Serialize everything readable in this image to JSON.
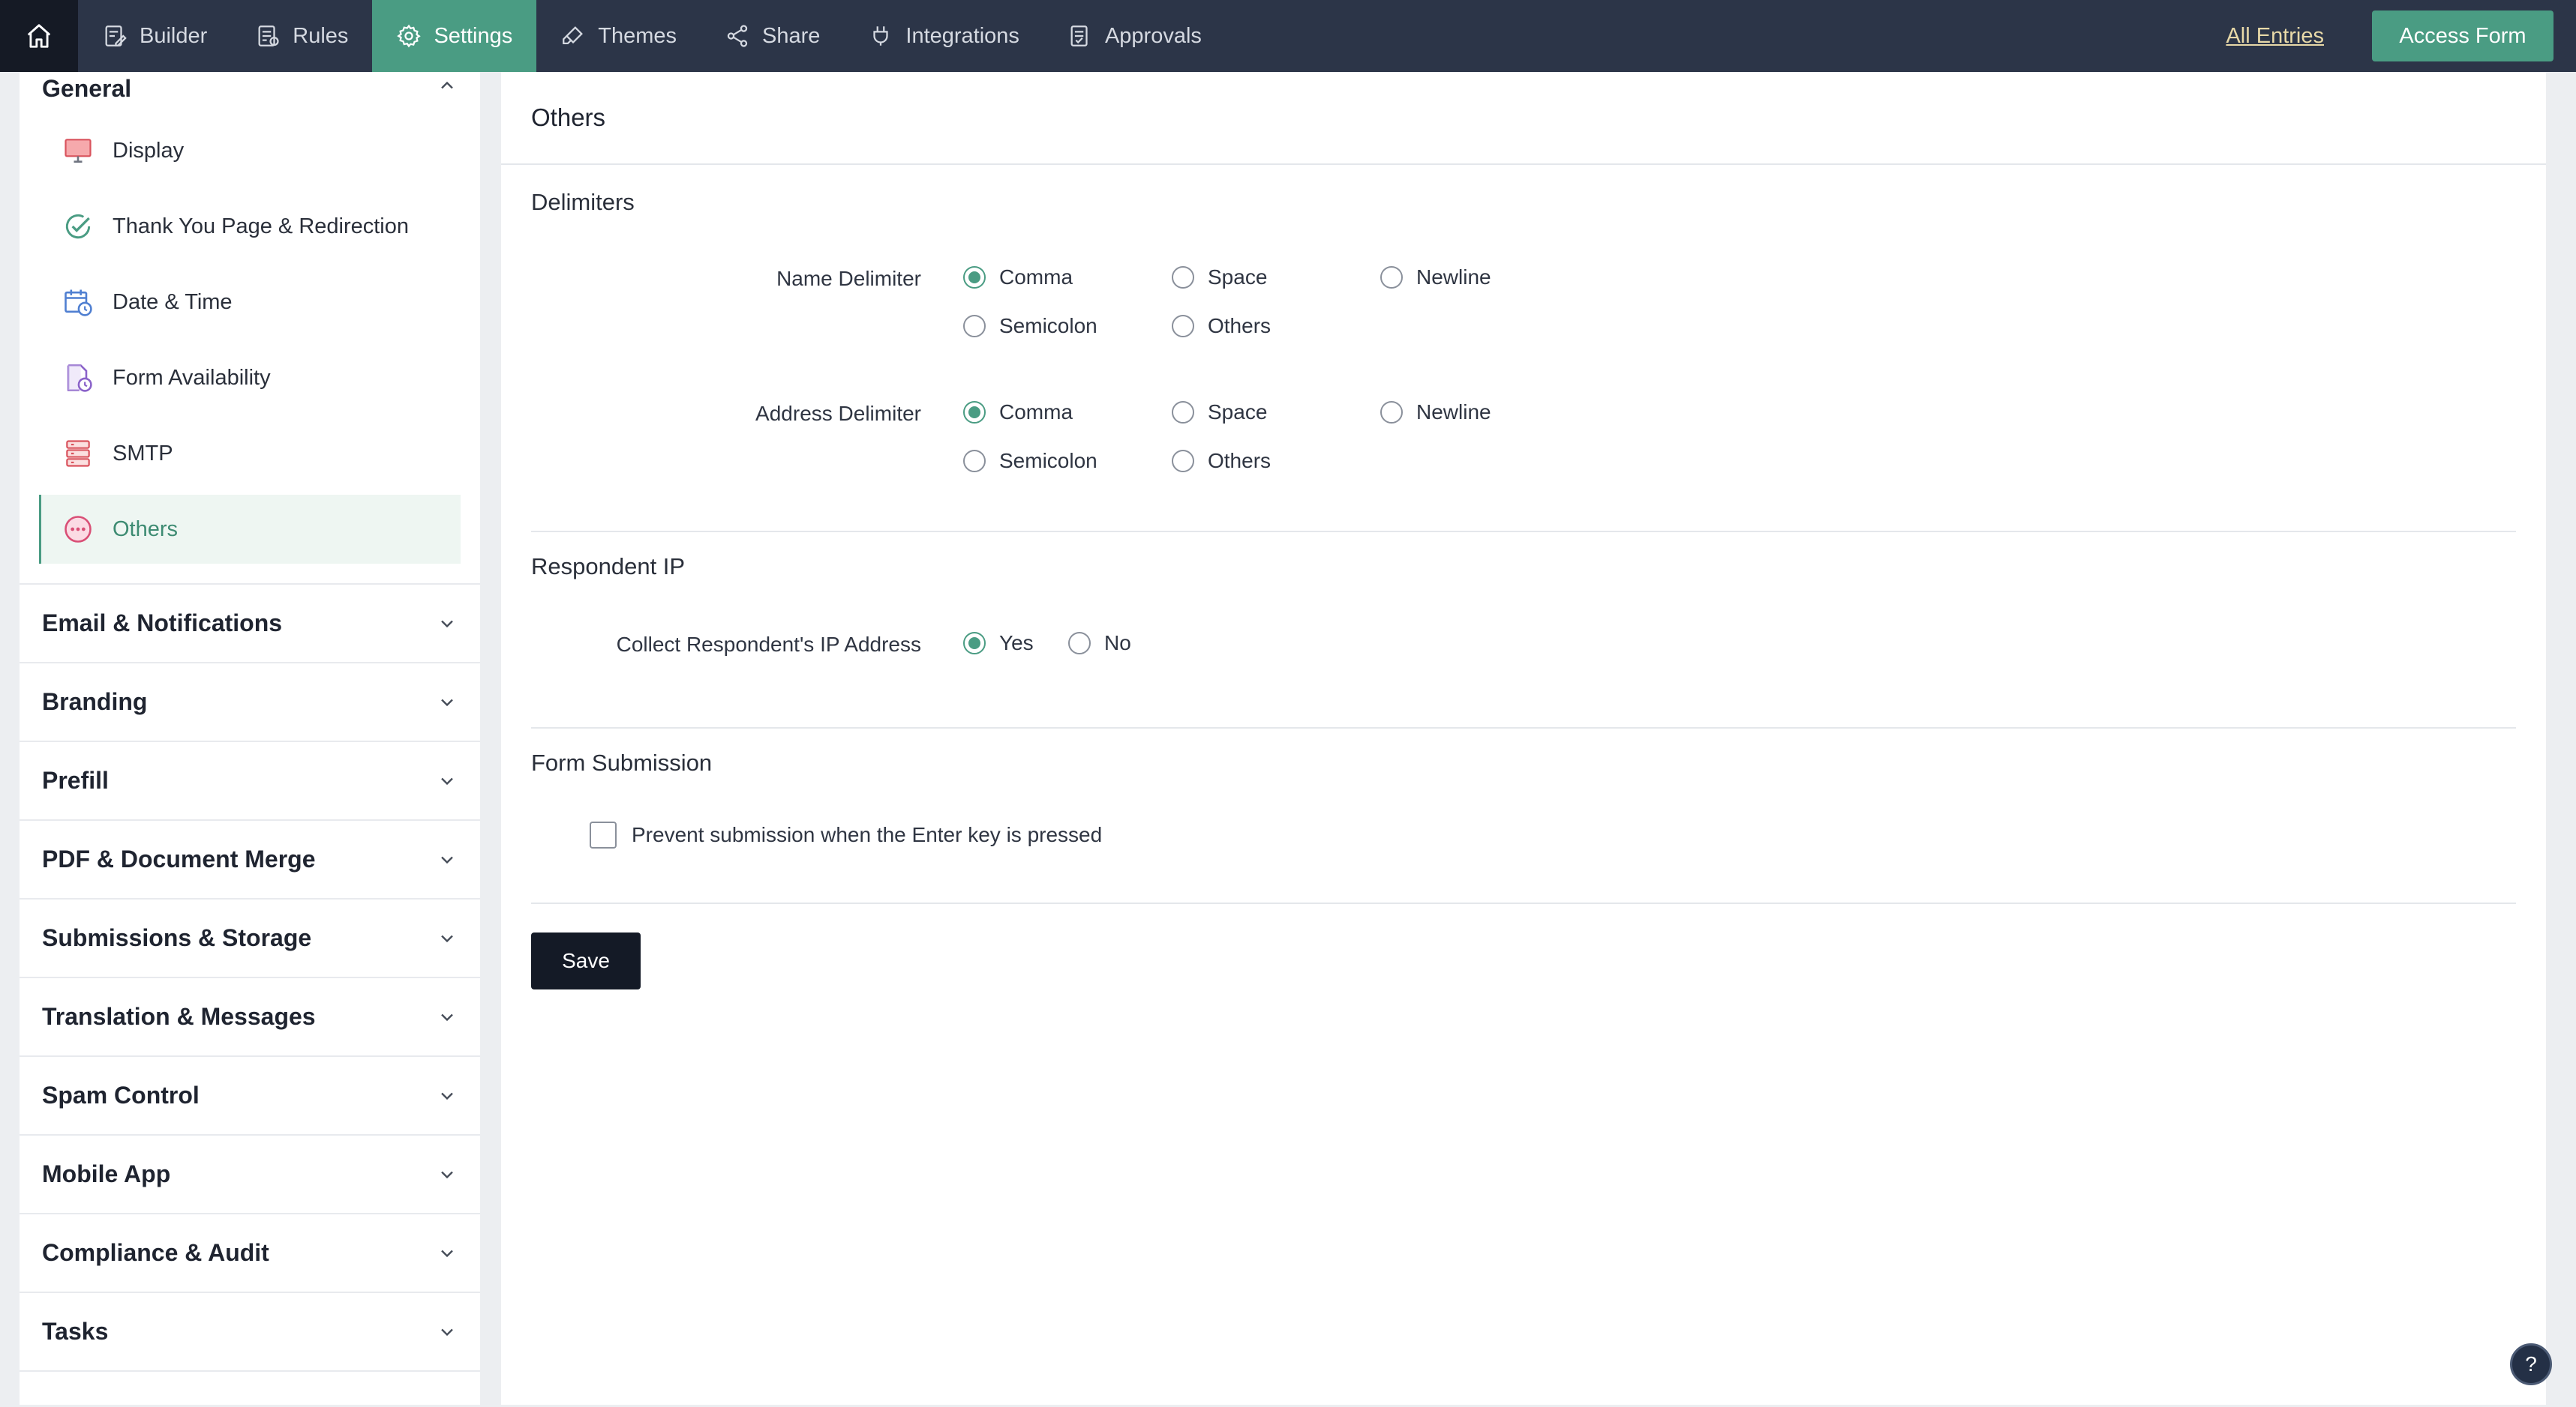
{
  "nav": {
    "tabs": [
      {
        "label": "Builder",
        "icon": "builder-icon"
      },
      {
        "label": "Rules",
        "icon": "rules-icon"
      },
      {
        "label": "Settings",
        "icon": "gear-icon",
        "active": true
      },
      {
        "label": "Themes",
        "icon": "brush-icon"
      },
      {
        "label": "Share",
        "icon": "share-icon"
      },
      {
        "label": "Integrations",
        "icon": "plug-icon"
      },
      {
        "label": "Approvals",
        "icon": "approvals-icon"
      }
    ],
    "all_entries": "All Entries",
    "access_form": "Access Form"
  },
  "sidebar": {
    "general": {
      "title": "General",
      "items": [
        {
          "label": "Display",
          "icon": "monitor-icon"
        },
        {
          "label": "Thank You Page & Redirection",
          "icon": "check-circle-icon"
        },
        {
          "label": "Date & Time",
          "icon": "calendar-clock-icon"
        },
        {
          "label": "Form Availability",
          "icon": "form-clock-icon"
        },
        {
          "label": "SMTP",
          "icon": "server-icon"
        },
        {
          "label": "Others",
          "icon": "more-circle-icon",
          "active": true
        }
      ]
    },
    "sections": [
      "Email & Notifications",
      "Branding",
      "Prefill",
      "PDF & Document Merge",
      "Submissions & Storage",
      "Translation & Messages",
      "Spam Control",
      "Mobile App",
      "Compliance & Audit",
      "Tasks"
    ]
  },
  "main": {
    "title": "Others",
    "delimiters": {
      "title": "Delimiters",
      "name": {
        "label": "Name Delimiter",
        "options": [
          "Comma",
          "Space",
          "Newline",
          "Semicolon",
          "Others"
        ],
        "selected": "Comma"
      },
      "address": {
        "label": "Address Delimiter",
        "options": [
          "Comma",
          "Space",
          "Newline",
          "Semicolon",
          "Others"
        ],
        "selected": "Comma"
      }
    },
    "respondent_ip": {
      "title": "Respondent IP",
      "label": "Collect Respondent's IP Address",
      "options": [
        "Yes",
        "No"
      ],
      "selected": "Yes"
    },
    "form_submission": {
      "title": "Form Submission",
      "checkbox_label": "Prevent submission when the Enter key is pressed",
      "checked": false
    },
    "save_label": "Save"
  },
  "help_label": "?",
  "colors": {
    "accent": "#4a9c83",
    "topbar": "#2c3548",
    "save": "#141a26"
  }
}
